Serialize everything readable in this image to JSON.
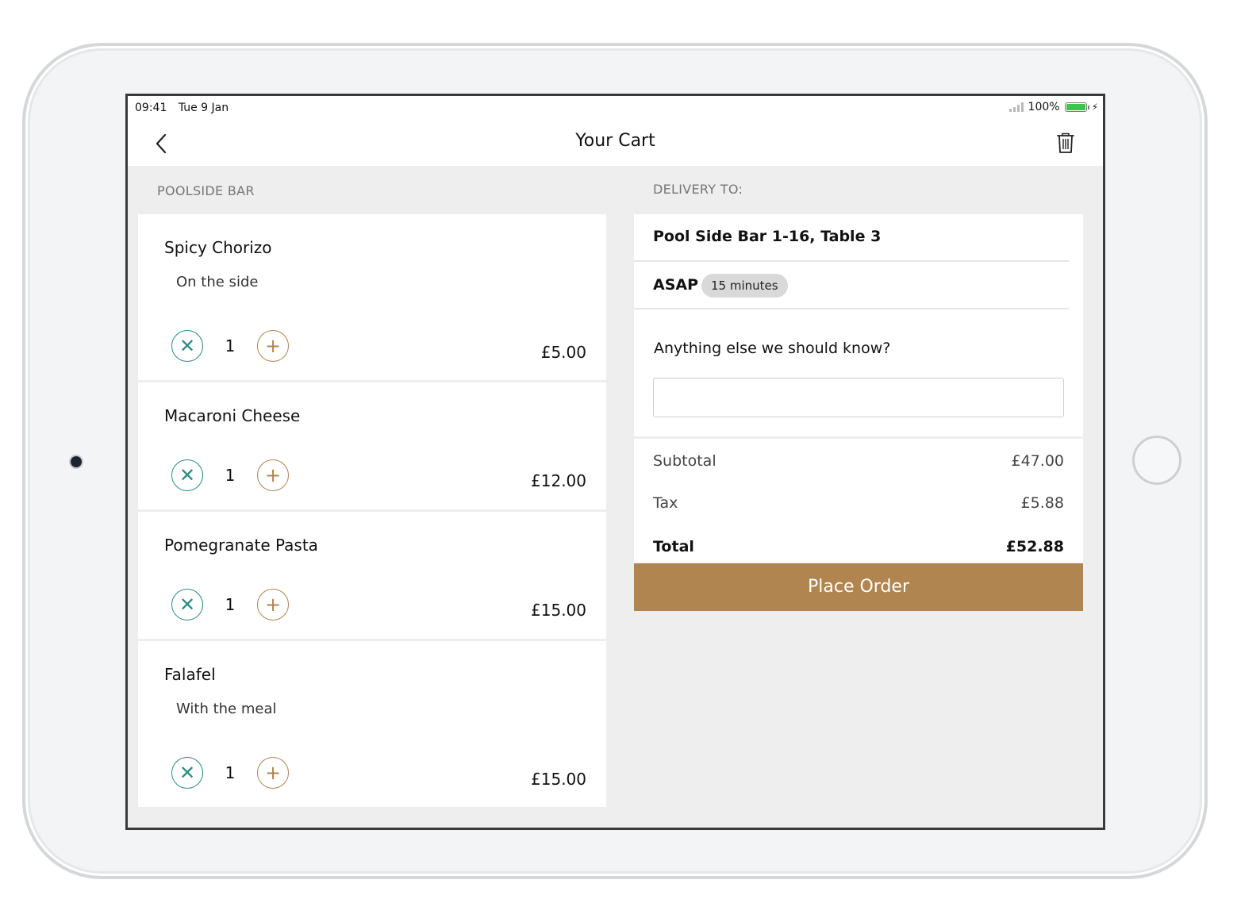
{
  "status": {
    "time": "09:41",
    "date": "Tue 9 Jan",
    "battery": "100%"
  },
  "nav": {
    "title": "Your Cart"
  },
  "left": {
    "section_label": "POOLSIDE BAR",
    "items": [
      {
        "name": "Spicy Chorizo",
        "note": "On the side",
        "qty": "1",
        "price": "£5.00"
      },
      {
        "name": "Macaroni Cheese",
        "note": "",
        "qty": "1",
        "price": "£12.00"
      },
      {
        "name": "Pomegranate Pasta",
        "note": "",
        "qty": "1",
        "price": "£15.00"
      },
      {
        "name": "Falafel",
        "note": "With the meal",
        "qty": "1",
        "price": "£15.00"
      }
    ]
  },
  "right": {
    "section_label": "DELIVERY TO:",
    "destination": "Pool Side Bar 1-16, Table 3",
    "timing": "ASAP",
    "timing_pill": "15 minutes",
    "notes_question": "Anything else we should know?",
    "notes_value": "",
    "subtotal_label": "Subtotal",
    "subtotal_value": "£47.00",
    "tax_label": "Tax",
    "tax_value": "£5.88",
    "total_label": "Total",
    "total_value": "£52.88",
    "place_order": "Place Order"
  },
  "colors": {
    "accent": "#b08550",
    "remove": "#2d8a86",
    "battery": "#3fc44a"
  },
  "icons": {
    "back": "chevron-left-icon",
    "trash": "trash-icon",
    "remove": "close-icon",
    "add": "plus-icon"
  }
}
